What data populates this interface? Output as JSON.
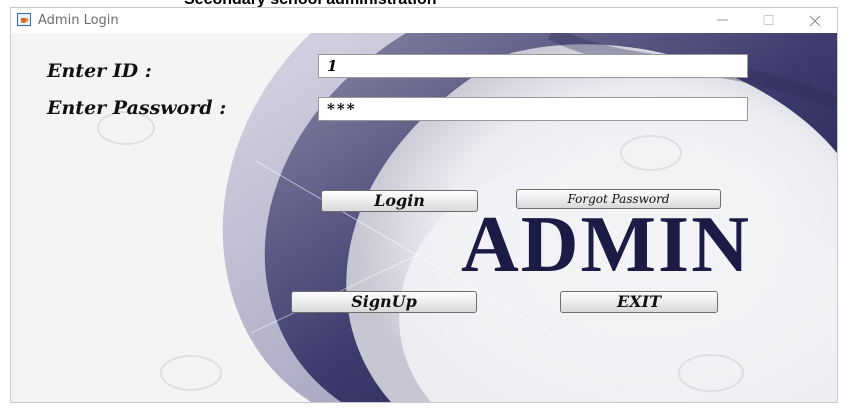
{
  "caption": "Secondary school administration",
  "window": {
    "title": "Admin Login",
    "icon": "java-cup-icon"
  },
  "form": {
    "id_label": "Enter ID :",
    "id_value": "1",
    "password_label": "Enter Password :",
    "password_value": "***"
  },
  "buttons": {
    "login": "Login",
    "forgot_password": "Forgot Password",
    "signup": "SignUp",
    "exit": "EXIT"
  },
  "background": {
    "brand_text": "ADMIN",
    "colors": {
      "navy": "#1c1b45",
      "purple": "#4a4878",
      "silver": "#e9e9ef"
    }
  }
}
